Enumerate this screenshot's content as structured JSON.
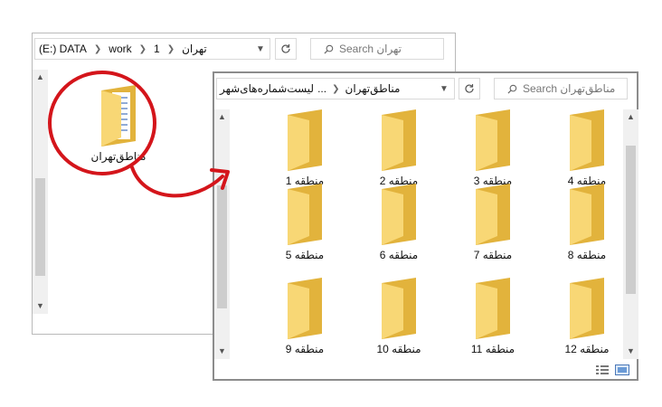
{
  "back_window": {
    "breadcrumb": [
      "(E:) DATA",
      "work",
      "1",
      "تهران"
    ],
    "search_placeholder": "Search تهران",
    "folder_label": "مناطق‌تهران"
  },
  "front_window": {
    "breadcrumb_left": "لیست‌شماره‌های‌شهر",
    "breadcrumb_ellipsis": "...",
    "breadcrumb_current": "مناطق‌تهران",
    "search_placeholder": "Search مناطق‌تهران",
    "folders": [
      {
        "label": "منطقه 4"
      },
      {
        "label": "منطقه 3"
      },
      {
        "label": "منطقه 2"
      },
      {
        "label": "منطقه 1"
      },
      {
        "label": "منطقه 8"
      },
      {
        "label": "منطقه 7"
      },
      {
        "label": "منطقه 6"
      },
      {
        "label": "منطقه 5"
      },
      {
        "label": "منطقه 12"
      },
      {
        "label": "منطقه 11"
      },
      {
        "label": "منطقه 10"
      },
      {
        "label": "منطقه 9"
      }
    ]
  },
  "colors": {
    "highlight_circle": "#d4151b",
    "folder_front": "#f8d775",
    "folder_back": "#e2b33c"
  },
  "icons": [
    "search-icon",
    "refresh-icon",
    "chevron-down-icon",
    "folder-icon",
    "details-view-icon",
    "large-icons-view-icon",
    "curved-arrow-icon"
  ]
}
